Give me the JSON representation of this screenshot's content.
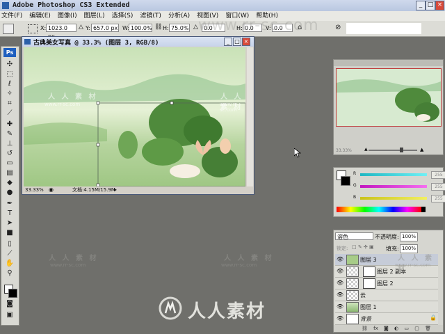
{
  "app": {
    "title": "Adobe Photoshop CS3 Extended"
  },
  "menubar": {
    "items": [
      "文件(F)",
      "编辑(E)",
      "图像(I)",
      "图层(L)",
      "选择(S)",
      "滤镜(T)",
      "分析(A)",
      "视图(V)",
      "窗口(W)",
      "帮助(H)"
    ]
  },
  "options": {
    "x_label": "X:",
    "x_value": "1023.0 px",
    "y_label": "Y:",
    "y_value": "657.0 px",
    "w_label": "W:",
    "w_value": "100.0%",
    "h_label": "H:",
    "h_value": "75.0%",
    "angle_value": "0.0",
    "hskew_label": "H:",
    "hskew_value": "0.0",
    "vskew_label": "V:",
    "vskew_value": "0.0",
    "watermark_url": "www.rr-sc.com"
  },
  "document": {
    "title": "古典美女写真 @ 33.3% (图层 3, RGB/8)",
    "zoom": "33.33%",
    "doc_size": "文档:4.15M/15.9M",
    "watermark_logo": "人 人 素 材",
    "watermark_url": "www.rr-sc.com"
  },
  "navigator": {
    "zoom": "33.33%"
  },
  "color": {
    "r_label": "R",
    "g_label": "G",
    "b_label": "B",
    "r_value": "255",
    "g_value": "255",
    "b_value": "255",
    "accent_r": "#29d6e0",
    "accent_g": "#e02fd6",
    "accent_b": "#e8e83a"
  },
  "layers": {
    "blend_mode": "溶色",
    "opacity_label": "不透明度:",
    "opacity_value": "100%",
    "lock_label": "锁定:",
    "fill_label": "填充:",
    "fill_value": "100%",
    "items": [
      {
        "name": "图层 3"
      },
      {
        "name": "图层 2 副本"
      },
      {
        "name": "图层 2"
      },
      {
        "name": "云"
      },
      {
        "name": "图层 1"
      },
      {
        "name": "背景"
      }
    ]
  },
  "watermarks": {
    "logo_text": "人人素材",
    "tiled_logo": "人 人 素 材",
    "tiled_url": "www.rr-sc.com"
  }
}
